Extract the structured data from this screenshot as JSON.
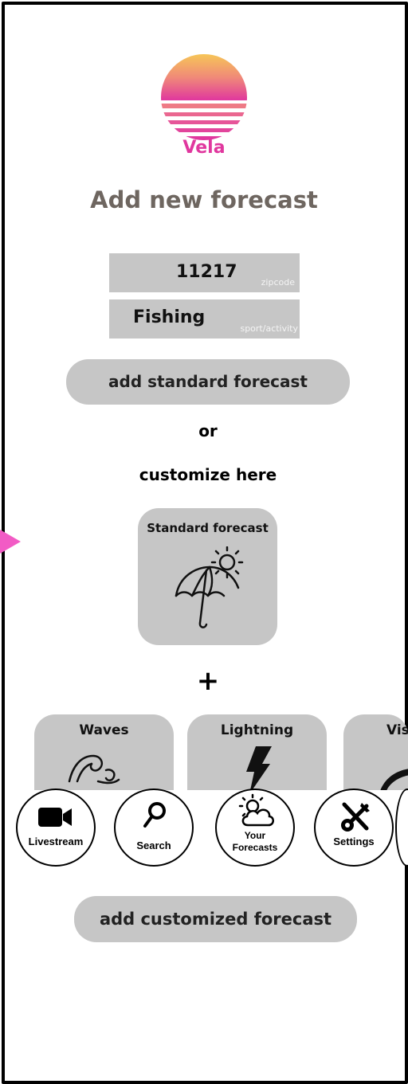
{
  "logo": {
    "brand": "Vela"
  },
  "title": "Add new forecast",
  "zipcode": {
    "value": "11217",
    "placeholder": "zipcode"
  },
  "sport": {
    "value": "Fishing",
    "placeholder": "sport/activity"
  },
  "buttons": {
    "standard": "add standard forecast",
    "customized": "add customized forecast"
  },
  "or_label": "or",
  "customize_label": "customize here",
  "standard_card": {
    "label": "Standard forecast",
    "icon": "umbrella-sun-icon"
  },
  "plus": "+",
  "option_cards": [
    {
      "label": "Waves",
      "icon": "wave-icon"
    },
    {
      "label": "Lightning",
      "icon": "lightning-icon"
    },
    {
      "label": "Vis",
      "icon": "visibility-icon"
    }
  ],
  "nav": [
    {
      "label": "Livestream",
      "icon": "video-camera-icon"
    },
    {
      "label": "Search",
      "icon": "search-icon"
    },
    {
      "label_line1": "Your",
      "label_line2": "Forecasts",
      "icon": "cloud-sun-icon"
    },
    {
      "label": "Settings",
      "icon": "tools-icon"
    }
  ],
  "colors": {
    "accent": "#e0379e",
    "arrow": "#f25bc5",
    "field_bg": "#c6c6c6",
    "title": "#6e6660"
  }
}
